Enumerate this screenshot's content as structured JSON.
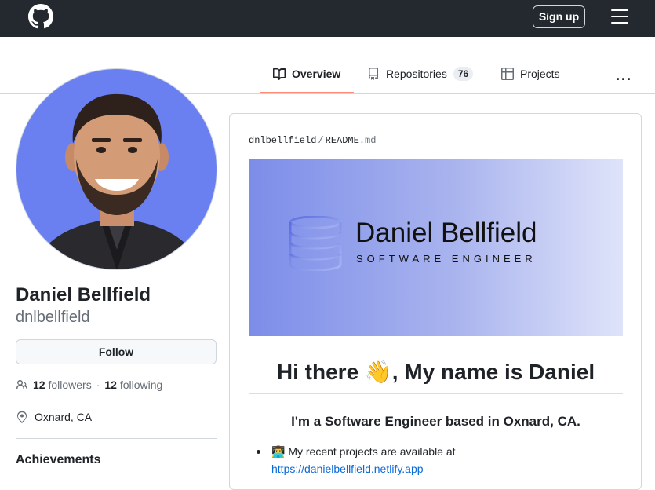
{
  "header": {
    "signup_label": "Sign up"
  },
  "tabs": [
    {
      "label": "Overview",
      "icon": "book-icon"
    },
    {
      "label": "Repositories",
      "count": "76",
      "icon": "repo-icon"
    },
    {
      "label": "Projects",
      "icon": "table-icon"
    }
  ],
  "more_label": "···",
  "profile": {
    "full_name": "Daniel Bellfield",
    "username": "dnlbellfield",
    "follow_label": "Follow",
    "followers_count": "12",
    "followers_label": "followers",
    "separator": "·",
    "following_count": "12",
    "following_label": "following",
    "location": "Oxnard, CA",
    "achievements_title": "Achievements"
  },
  "readme": {
    "owner": "dnlbellfield",
    "separator": "/",
    "file_base": "README",
    "file_ext": ".md",
    "banner_name": "Daniel Bellfield",
    "banner_role": "SOFTWARE ENGINEER",
    "greeting": "Hi there 👋, My name is Daniel",
    "intro": "I'm a Software Engineer based in Oxnard, CA.",
    "bullet_text": "👨‍💻 My recent projects are available at",
    "bullet_link": "https://danielbellfield.netlify.app"
  },
  "colors": {
    "header_bg": "#24292f",
    "tab_underline": "#fd8c73",
    "link": "#0969da",
    "avatar_bg": "#6b80f0"
  }
}
